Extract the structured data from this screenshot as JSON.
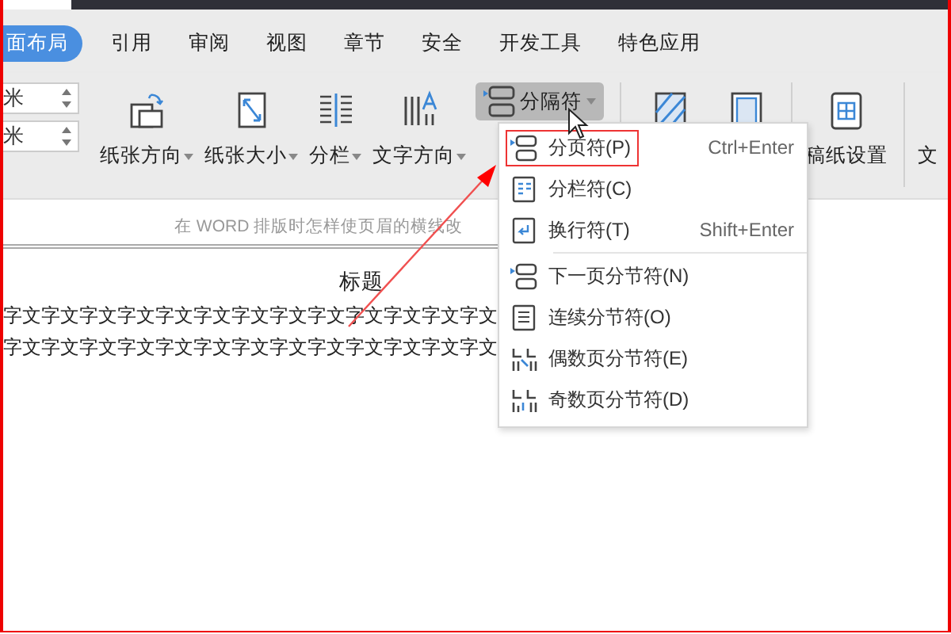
{
  "tabs": [
    {
      "label": "面布局",
      "selected": true
    },
    {
      "label": "引用",
      "selected": false
    },
    {
      "label": "审阅",
      "selected": false
    },
    {
      "label": "视图",
      "selected": false
    },
    {
      "label": "章节",
      "selected": false
    },
    {
      "label": "安全",
      "selected": false
    },
    {
      "label": "开发工具",
      "selected": false
    },
    {
      "label": "特色应用",
      "selected": false
    }
  ],
  "margin_fields": [
    {
      "value": "米"
    },
    {
      "value": "米"
    }
  ],
  "ribbon": [
    {
      "kind": "large",
      "label": "纸张方向",
      "dropdown": true,
      "pressed": false
    },
    {
      "kind": "large",
      "label": "纸张大小",
      "dropdown": true,
      "pressed": false
    },
    {
      "kind": "large",
      "label": "分栏",
      "dropdown": true,
      "pressed": false
    },
    {
      "kind": "large",
      "label": "文字方向",
      "dropdown": true,
      "pressed": false
    },
    {
      "kind": "inline",
      "label": "分隔符",
      "dropdown": true,
      "pressed": true
    },
    {
      "kind": "sep"
    },
    {
      "kind": "iconOnly"
    },
    {
      "kind": "iconOnly"
    },
    {
      "kind": "sep"
    },
    {
      "kind": "large",
      "label": "稿纸设置",
      "dropdown": false,
      "pressed": false
    },
    {
      "kind": "sep"
    },
    {
      "kind": "large",
      "label": "文",
      "dropdown": false,
      "pressed": false
    }
  ],
  "document": {
    "title": "在 WORD 排版时怎样使页眉的横线改",
    "heading": "标题",
    "lines": [
      "字文字文字文字文字文字文字文字文字文字文字文字文字文",
      "字文字文字文字文字文字文字文字文字文字文字文字文字文"
    ]
  },
  "menu": {
    "groups": [
      [
        {
          "label": "分页符(P)",
          "shortcut": "Ctrl+Enter",
          "highlighted": true
        },
        {
          "label": "分栏符(C)",
          "highlighted": false
        },
        {
          "label": "换行符(T)",
          "shortcut": "Shift+Enter",
          "highlighted": false
        }
      ],
      [
        {
          "label": "下一页分节符(N)",
          "highlighted": false
        },
        {
          "label": "连续分节符(O)",
          "highlighted": false
        },
        {
          "label": "偶数页分节符(E)",
          "highlighted": false
        },
        {
          "label": "奇数页分节符(D)",
          "highlighted": false
        }
      ]
    ]
  }
}
